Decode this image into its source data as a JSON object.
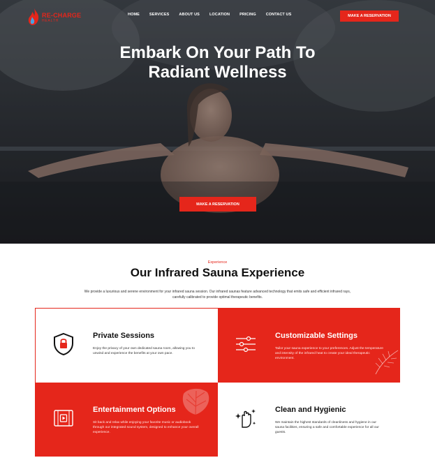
{
  "header": {
    "logo": {
      "brand": "RE-CHARGE",
      "sub": "HEALTH"
    },
    "nav": [
      "HOME",
      "SERVICES",
      "ABOUT US",
      "LOCATION",
      "PRICING",
      "CONTACT US"
    ],
    "cta_label": "MAKE A RESERVATION"
  },
  "hero": {
    "title_line1": "Embark On Your Path To",
    "title_line2": "Radiant Wellness",
    "cta_label": "MAKE A RESERVATION"
  },
  "experience": {
    "eyebrow": "Experience",
    "title": "Our Infrared Sauna Experience",
    "description": "We provide a luxurious and serene environment for your infrared sauna session. Our infrared saunas feature advanced technology that emits safe and efficient infrared rays, carefully calibrated to provide optimal therapeutic benefits.",
    "cards": [
      {
        "title": "Private Sessions",
        "desc": "Enjoy the privacy of your own dedicated sauna room, allowing you to unwind and experience the benefits at your own pace.",
        "icon": "shield-lock-icon"
      },
      {
        "title": "Customizable Settings",
        "desc": "Tailor your sauna experience to your preferences. Adjust the temperature and intensity of the infrared heat to create your ideal therapeutic environment.",
        "icon": "sliders-icon"
      },
      {
        "title": "Entertainment Options",
        "desc": "Sit back and relax while enjoying your favorite music or audiobook through our integrated sound system, designed to enhance your overall experience.",
        "icon": "video-player-icon"
      },
      {
        "title": "Clean and Hygienic",
        "desc": "We maintain the highest standards of cleanliness and hygiene in our sauna facilities, ensuring a safe and comfortable experience for all our guests.",
        "icon": "sparkle-hand-icon"
      }
    ]
  },
  "colors": {
    "accent": "#e5261b",
    "dark": "#2c2f34",
    "white": "#ffffff"
  }
}
